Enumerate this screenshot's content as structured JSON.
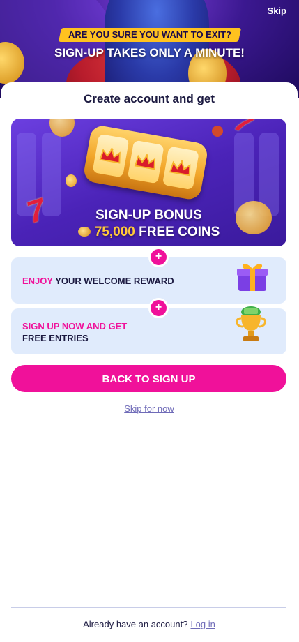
{
  "header": {
    "skip_label": "Skip",
    "exit_question": "ARE YOU SURE YOU WANT TO EXIT?",
    "signup_note": "SIGN-UP TAKES ONLY A MINUTE!"
  },
  "main": {
    "title": "Create account and get",
    "bonus": {
      "line1": "SIGN-UP BONUS",
      "amount": "75,000",
      "coins_label": "FREE COINS"
    },
    "perks": [
      {
        "highlight": "ENJOY",
        "text": "YOUR WELCOME REWARD",
        "icon": "gift-icon"
      },
      {
        "highlight": "SIGN UP NOW AND GET",
        "text": "FREE ENTRIES",
        "icon": "trophy-icon"
      }
    ],
    "plus_symbol": "+",
    "cta_label": "BACK TO SIGN UP",
    "skip_now_label": "Skip for now"
  },
  "footer": {
    "question": "Already have an account?",
    "login_label": "Log in"
  },
  "colors": {
    "accent_pink": "#f0119a",
    "navy_text": "#1b1940",
    "perk_bg": "#e0ebfc",
    "link": "#6f6bb8",
    "banner_yellow": "#ffc21f",
    "hero_purple": "#3b1890"
  }
}
